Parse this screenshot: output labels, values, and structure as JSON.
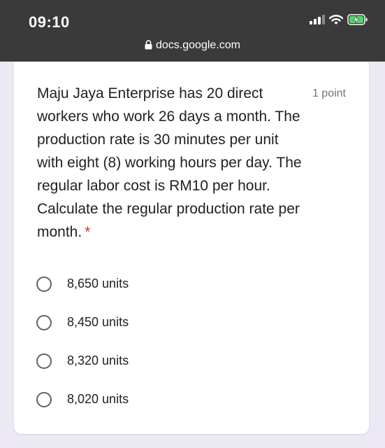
{
  "status": {
    "time": "09:10",
    "url": "docs.google.com"
  },
  "form": {
    "question": "Maju Jaya Enterprise has 20 direct workers who work 26 days a month. The production rate is 30 minutes per unit with eight (8) working hours per day. The regular labor cost is RM10 per hour. Calculate the regular production rate per month.",
    "required_mark": "*",
    "points": "1 point",
    "options": [
      {
        "label": "8,650 units"
      },
      {
        "label": "8,450 units"
      },
      {
        "label": "8,320 units"
      },
      {
        "label": "8,020 units"
      }
    ]
  },
  "icons": {
    "signal": "signal-icon",
    "wifi": "wifi-icon",
    "battery": "battery-charging-icon",
    "lock": "lock-icon",
    "radio": "radio-unchecked-icon"
  },
  "colors": {
    "status_bar": "#3a3a3a",
    "page_background": "#ece9f4",
    "required": "#d93025",
    "battery": "#4cd964"
  }
}
